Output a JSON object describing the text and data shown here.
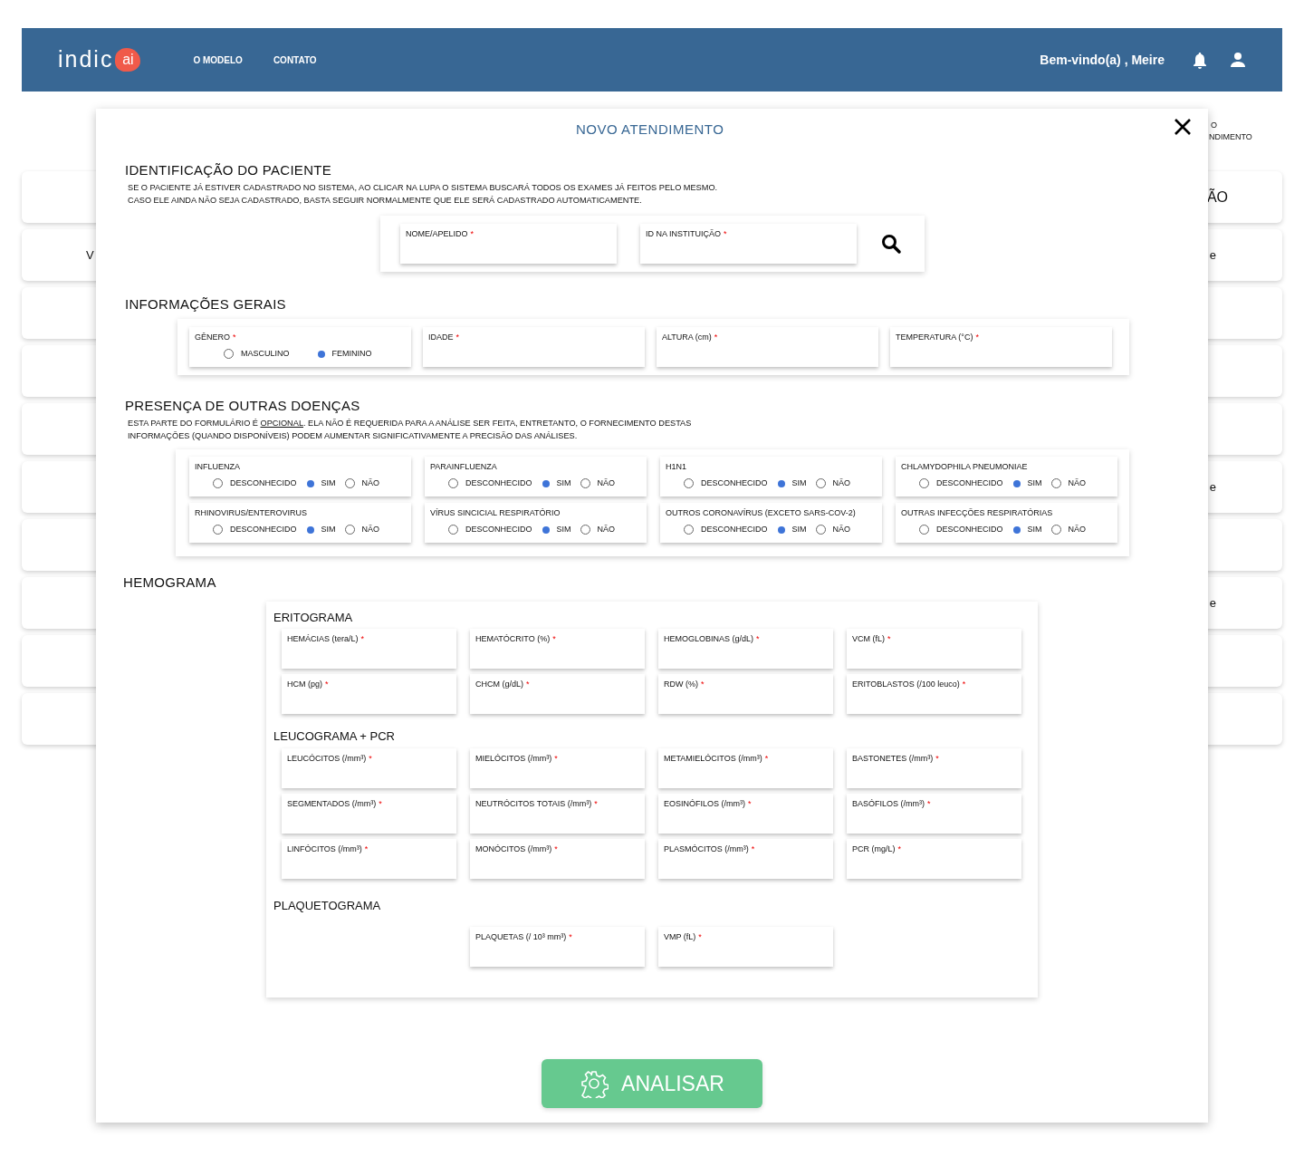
{
  "navbar": {
    "logo": {
      "text": "indic",
      "badge": "ai"
    },
    "links": [
      "O MODELO",
      "CONTATO"
    ],
    "greeting": "Bem-vindo(a) , Meire"
  },
  "toolbar": {
    "new_button_lines": [
      "O",
      "NDIMENTO"
    ]
  },
  "background_table": {
    "header": {
      "end_text": "ÃO"
    },
    "rows": [
      {
        "start_text": "V",
        "end_text": "e"
      },
      {},
      {},
      {},
      {
        "end_text": "e"
      },
      {},
      {
        "end_text": "e"
      },
      {},
      {}
    ]
  },
  "modal": {
    "title": "NOVO ATENDIMENTO",
    "identification": {
      "heading": "IDENTIFICAÇÃO DO PACIENTE",
      "description": [
        {
          "text": "SE O PACIENTE JÁ ESTIVER CADASTRADO NO SISTEMA, AO CLICAR NA LUPA O SISTEMA BUSCARÁ TODOS OS EXAMES JÁ FEITOS PELO MESMO. CASO ELE AINDA NÃO SEJA CADASTRADO, BASTA SEGUIR NORMALMENTE QUE ELE SERÁ CADASTRADO AUTOMATICAMENTE.",
          "underline": false
        }
      ],
      "fields": [
        {
          "label": "NOME/APELIDO",
          "required_mark": "*"
        },
        {
          "label": "ID NA INSTITUIÇÃO",
          "required_mark": "*"
        }
      ]
    },
    "general": {
      "heading": "INFORMAÇÕES GERAIS",
      "gender": {
        "label": "GÊNERO",
        "required_mark": "*",
        "options": [
          {
            "label": "MASCULINO",
            "selected": false
          },
          {
            "label": "FEMININO",
            "selected": true
          }
        ]
      },
      "fields": [
        {
          "label": "IDADE",
          "required_mark": "*"
        },
        {
          "label": "ALTURA (cm)",
          "required_mark": "*"
        },
        {
          "label": "TEMPERATURA (°C)",
          "required_mark": "*"
        }
      ]
    },
    "diseases": {
      "heading": "PRESENÇA DE OUTRAS DOENÇAS",
      "description": [
        {
          "text": "ESTA PARTE DO FORMULÁRIO É ",
          "underline": false
        },
        {
          "text": "OPCIONAL",
          "underline": true
        },
        {
          "text": ". ELA NÃO É REQUERIDA PARA A ANÁLISE SER FEITA, ENTRETANTO, O FORNECIMENTO DESTAS INFORMAÇÕES (QUANDO DISPONÍVEIS) PODEM AUMENTAR SIGNIFICATIVAMENTE A PRECISÃO DAS ANÁLISES.",
          "underline": false
        }
      ],
      "items": [
        {
          "label": "INFLUENZA",
          "options": [
            {
              "label": "DESCONHECIDO",
              "selected": false
            },
            {
              "label": "SIM",
              "selected": true
            },
            {
              "label": "NÃO",
              "selected": false
            }
          ]
        },
        {
          "label": "PARAINFLUENZA",
          "options": [
            {
              "label": "DESCONHECIDO",
              "selected": false
            },
            {
              "label": "SIM",
              "selected": true
            },
            {
              "label": "NÃO",
              "selected": false
            }
          ]
        },
        {
          "label": "H1N1",
          "options": [
            {
              "label": "DESCONHECIDO",
              "selected": false
            },
            {
              "label": "SIM",
              "selected": true
            },
            {
              "label": "NÃO",
              "selected": false
            }
          ]
        },
        {
          "label": "CHLAMYDOPHILA PNEUMONIAE",
          "options": [
            {
              "label": "DESCONHECIDO",
              "selected": false
            },
            {
              "label": "SIM",
              "selected": true
            },
            {
              "label": "NÃO",
              "selected": false
            }
          ]
        },
        {
          "label": "RHINOVIRUS/ENTEROVIRUS",
          "options": [
            {
              "label": "DESCONHECIDO",
              "selected": false
            },
            {
              "label": "SIM",
              "selected": true
            },
            {
              "label": "NÃO",
              "selected": false
            }
          ]
        },
        {
          "label": "VÍRUS SINCICIAL RESPIRATÓRIO",
          "options": [
            {
              "label": "DESCONHECIDO",
              "selected": false
            },
            {
              "label": "SIM",
              "selected": true
            },
            {
              "label": "NÃO",
              "selected": false
            }
          ]
        },
        {
          "label": "OUTROS CORONAVÍRUS (EXCETO SARS-COV-2)",
          "options": [
            {
              "label": "DESCONHECIDO",
              "selected": false
            },
            {
              "label": "SIM",
              "selected": true
            },
            {
              "label": "NÃO",
              "selected": false
            }
          ]
        },
        {
          "label": "OUTRAS INFECÇÕES RESPIRATÓRIAS",
          "options": [
            {
              "label": "DESCONHECIDO",
              "selected": false
            },
            {
              "label": "SIM",
              "selected": true
            },
            {
              "label": "NÃO",
              "selected": false
            }
          ]
        }
      ]
    },
    "hemogram": {
      "heading": "HEMOGRAMA",
      "groups": [
        {
          "title": "ERITOGRAMA",
          "fields": [
            {
              "label": "HEMÁCIAS (tera/L)",
              "required_mark": "*"
            },
            {
              "label": "HEMATÓCRITO (%)",
              "required_mark": "*"
            },
            {
              "label": "HEMOGLOBINAS (g/dL)",
              "required_mark": "*"
            },
            {
              "label": "VCM (fL)",
              "required_mark": "*"
            },
            {
              "label": "HCM (pg)",
              "required_mark": "*"
            },
            {
              "label": "CHCM (g/dL)",
              "required_mark": "*"
            },
            {
              "label": "RDW (%)",
              "required_mark": "*"
            },
            {
              "label": "ERITOBLASTOS (/100 leuco)",
              "required_mark": "*"
            }
          ]
        },
        {
          "title": "LEUCOGRAMA + PCR",
          "fields": [
            {
              "label": "LEUCÓCITOS (/mm³)",
              "required_mark": "*"
            },
            {
              "label": "MIELÓCITOS (/mm³)",
              "required_mark": "*"
            },
            {
              "label": "METAMIELÓCITOS (/mm³)",
              "required_mark": "*"
            },
            {
              "label": "BASTONETES (/mm³)",
              "required_mark": "*"
            },
            {
              "label": "SEGMENTADOS (/mm³)",
              "required_mark": "*"
            },
            {
              "label": "NEUTRÓCITOS TOTAIS (/mm³)",
              "required_mark": "*"
            },
            {
              "label": "EOSINÓFILOS (/mm³)",
              "required_mark": "*"
            },
            {
              "label": "BASÓFILOS (/mm³)",
              "required_mark": "*"
            },
            {
              "label": "LINFÓCITOS (/mm³)",
              "required_mark": "*"
            },
            {
              "label": "MONÓCITOS (/mm³)",
              "required_mark": "*"
            },
            {
              "label": "PLASMÓCITOS (/mm³)",
              "required_mark": "*"
            },
            {
              "label": "PCR (mg/L)",
              "required_mark": "*"
            }
          ]
        },
        {
          "title": "PLAQUETOGRAMA",
          "fields": [
            {
              "label": "PLAQUETAS (/ 10³ mm³)",
              "required_mark": "*"
            },
            {
              "label": "VMP (fL)",
              "required_mark": "*"
            }
          ]
        }
      ]
    },
    "submit": "ANALISAR"
  }
}
